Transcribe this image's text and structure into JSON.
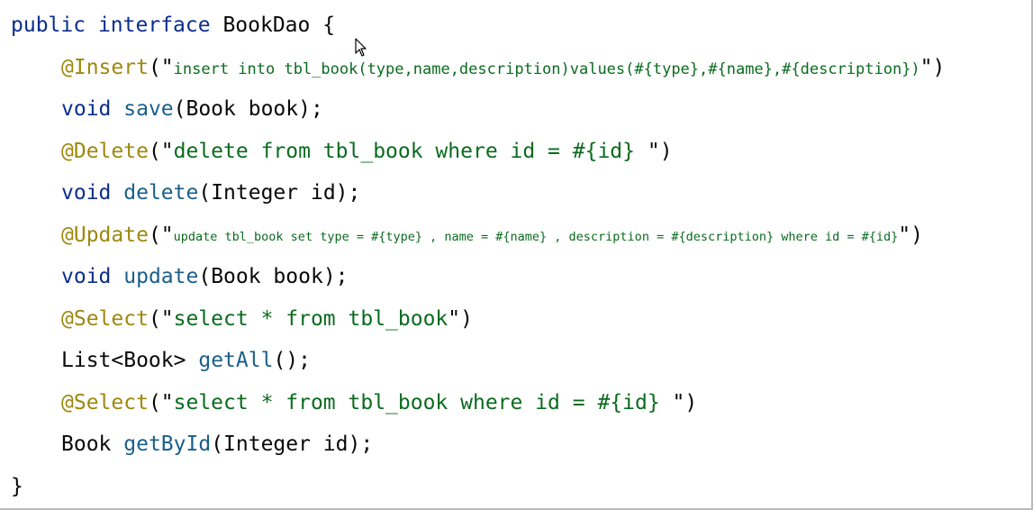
{
  "code": {
    "line1": {
      "kw1": "public",
      "kw2": "interface",
      "name": "BookDao",
      "brace": "{"
    },
    "line2": {
      "annotation": "@Insert",
      "open": "(\"",
      "sql": "insert into tbl_book(type,name,description)values(#{type},#{name},#{description})",
      "close": "\")"
    },
    "line3": {
      "type": "void",
      "method": "save",
      "params": "(Book book);"
    },
    "line4": {
      "annotation": "@Delete",
      "open": "(\"",
      "sql": "delete from tbl_book where id = #{id} ",
      "close": "\")"
    },
    "line5": {
      "type": "void",
      "method": "delete",
      "params": "(Integer id);"
    },
    "line6": {
      "annotation": "@Update",
      "open": "(\"",
      "sql": "update tbl_book set type = #{type} , name = #{name} , description = #{description} where id = #{id}",
      "close": "\")"
    },
    "line7": {
      "type": "void",
      "method": "update",
      "params": "(Book book);"
    },
    "line8": {
      "annotation": "@Select",
      "open": "(\"",
      "sql": "select * from tbl_book",
      "close": "\")"
    },
    "line9": {
      "type": "List<Book>",
      "method": "getAll",
      "params": "();"
    },
    "line10": {
      "annotation": "@Select",
      "open": "(\"",
      "sql": "select * from tbl_book where id = #{id} ",
      "close": "\")"
    },
    "line11": {
      "type": "Book",
      "method": "getById",
      "params": "(Integer id);"
    },
    "line12": {
      "brace": "}"
    }
  },
  "colors": {
    "keyword": "#0b2e8c",
    "annotation": "#9e880d",
    "string": "#0b6b1f",
    "method": "#1a5f8a"
  },
  "cursor_icon": "mouse-pointer-icon"
}
